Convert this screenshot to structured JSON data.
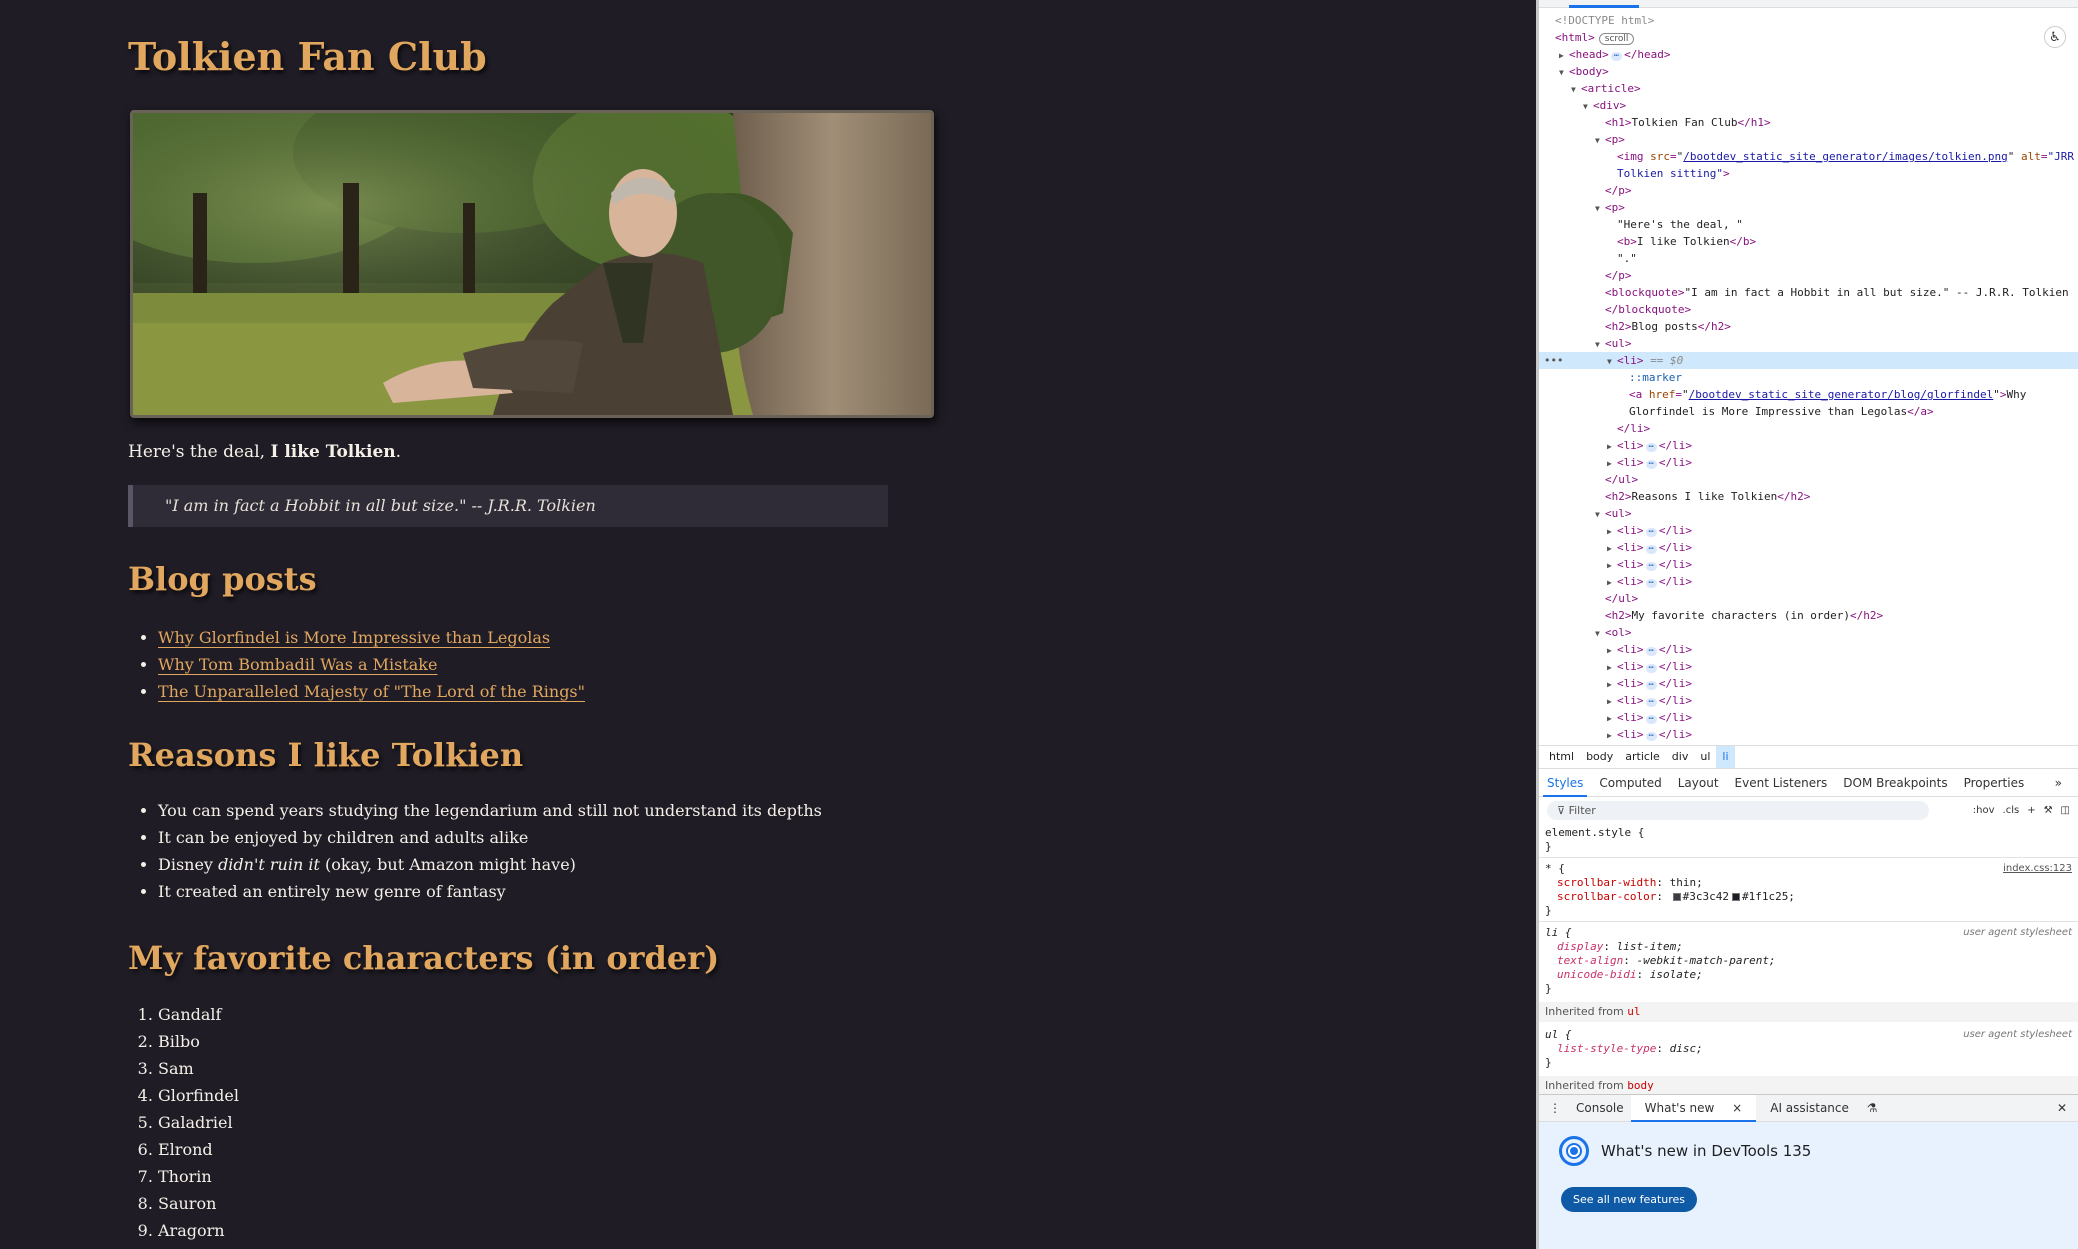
{
  "page": {
    "title": "Tolkien Fan Club",
    "image_alt": "JRR Tolkien sitting",
    "intro_prefix": "Here's the deal, ",
    "intro_bold": "I like Tolkien",
    "intro_suffix": ".",
    "quote": "\"I am in fact a Hobbit in all but size.\" -- J.R.R. Tolkien",
    "blog_heading": "Blog posts",
    "blog_posts": [
      "Why Glorfindel is More Impressive than Legolas",
      "Why Tom Bombadil Was a Mistake",
      "The Unparalleled Majesty of \"The Lord of the Rings\""
    ],
    "reasons_heading": "Reasons I like Tolkien",
    "reasons": {
      "r1": "You can spend years studying the legendarium and still not understand its depths",
      "r2": "It can be enjoyed by children and adults alike",
      "r3_prefix": "Disney ",
      "r3_em": "didn't ruin it",
      "r3_suffix": " (okay, but Amazon might have)",
      "r4": "It created an entirely new genre of fantasy"
    },
    "characters_heading": "My favorite characters (in order)",
    "characters": [
      "Gandalf",
      "Bilbo",
      "Sam",
      "Glorfindel",
      "Galadriel",
      "Elrond",
      "Thorin",
      "Sauron",
      "Aragorn"
    ]
  },
  "devtools": {
    "doctype": "<!DOCTYPE html>",
    "html_tag": "<html>",
    "scroll_badge": "scroll",
    "head": "<head>",
    "head_close": "</head>",
    "body": "<body>",
    "article": "<article>",
    "div": "<div>",
    "h1_open": "<h1>",
    "h1_text": "Tolkien Fan Club",
    "h1_close": "</h1>",
    "p_open": "<p>",
    "p_close": "</p>",
    "img_prefix": "<img ",
    "src_attr": "src",
    "img_src": "/bootdev_static_site_generator/images/tolkien.png",
    "alt_attr": "alt",
    "img_alt_part1": "\"JRR",
    "img_alt_part2": "Tolkien sitting\"",
    "tag_end": ">",
    "text_heres": "\"Here's the deal, \"",
    "b_open": "<b>",
    "b_text": "I like Tolkien",
    "b_close": "</b>",
    "text_period": "\".\"",
    "blockquote_open": "<blockquote>",
    "blockquote_text": "\"I am in fact a Hobbit in all but size.\" -- J.R.R. Tolkien",
    "blockquote_close": "</blockquote>",
    "h2_open": "<h2>",
    "h2_close": "</h2>",
    "h2_blog": "Blog posts",
    "ul_open": "<ul>",
    "ul_close": "</ul>",
    "li_open": "<li>",
    "li_close": "</li>",
    "selected_marker": "== $0",
    "marker": "::marker",
    "a_prefix": "<a ",
    "href_attr": "href",
    "a_href": "/bootdev_static_site_generator/blog/glorfindel",
    "a_text1": "Why",
    "a_text2": "Glorfindel is More Impressive than Legolas",
    "a_close": "</a>",
    "h2_reasons": "Reasons I like Tolkien",
    "h2_chars": "My favorite characters (in order)",
    "ol_open": "<ol>",
    "ellipsis": "⋯",
    "eq": "=",
    "row_dots": "•••",
    "accessibility_icon": "♿"
  },
  "breadcrumbs": [
    "html",
    "body",
    "article",
    "div",
    "ul",
    "li"
  ],
  "styles_tabs": [
    "Styles",
    "Computed",
    "Layout",
    "Event Listeners",
    "DOM Breakpoints",
    "Properties"
  ],
  "styles_more": "»",
  "filter": {
    "placeholder": "Filter",
    "hov": ":hov",
    ".cls": ".cls",
    "cls": ".cls",
    "add": "+",
    "paint": "⚒",
    "toggle": "◫"
  },
  "rules": {
    "element_style": "element.style {",
    "close": "}",
    "star_sel": "* {",
    "star_src": "index.css:123",
    "p1": "scrollbar-width",
    "v1": "thin;",
    "p2": "scrollbar-color",
    "v2a": "#3c3c42",
    "v2b": "#1f1c25;",
    "li_sel": "li {",
    "ua": "user agent stylesheet",
    "p3": "display",
    "v3": "list-item;",
    "p4": "text-align",
    "v4": "-webkit-match-parent;",
    "p5": "unicode-bidi",
    "v5": "isolate;",
    "inh_label": "Inherited from ",
    "inh_ul": "ul",
    "ul_sel": "ul {",
    "p6": "list-style-type",
    "v6": "disc;",
    "inh_body": "body",
    "colon": ": "
  },
  "drawer": {
    "kebab": "⋮",
    "tabs": [
      "Console",
      "What's new",
      "AI assistance"
    ],
    "tab_close": "×",
    "ai_icon": "⚗",
    "close": "✕",
    "heading": "What's new in DevTools 135",
    "button": "See all new features"
  },
  "colors": {
    "page_bg": "#1f1c25",
    "heading": "#e1a75f",
    "text": "#f4f0e8",
    "quote_bg": "#2f2c37",
    "devtools_accent": "#1a73e8",
    "swatch1": "#3c3c42",
    "swatch2": "#1f1c25"
  }
}
